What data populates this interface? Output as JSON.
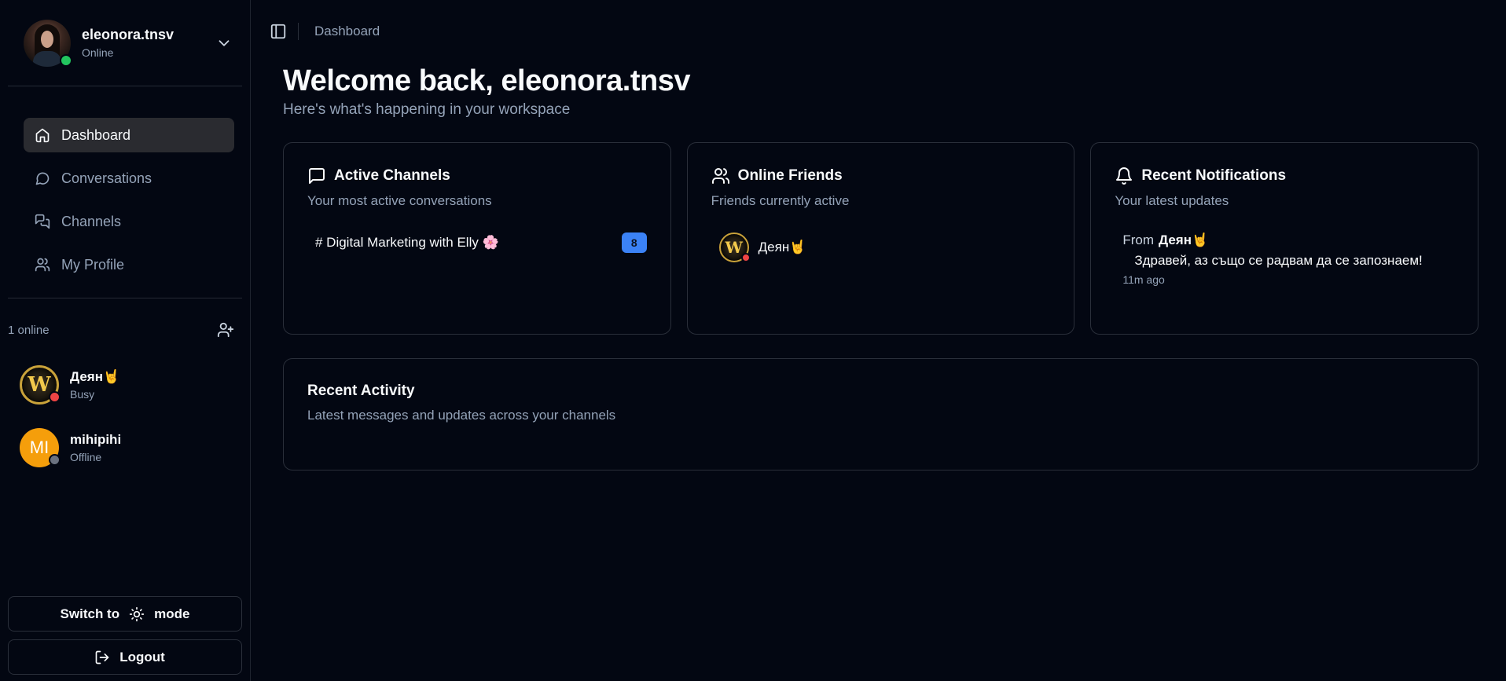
{
  "colors": {
    "background": "#030712",
    "accent": "#3b82f6",
    "online": "#22c55e",
    "busy": "#ef4444",
    "offline": "#6b7280",
    "initials_bg": "#f59e0b"
  },
  "sidebar": {
    "user": {
      "name": "eleonora.tnsv",
      "status": "Online"
    },
    "nav": [
      {
        "label": "Dashboard",
        "icon": "home-icon",
        "active": true
      },
      {
        "label": "Conversations",
        "icon": "chat-bubble-icon"
      },
      {
        "label": "Channels",
        "icon": "chat-bubbles-icon"
      },
      {
        "label": "My Profile",
        "icon": "users-icon"
      }
    ],
    "online_count": "1 online",
    "friends": [
      {
        "name": "Деян🤘",
        "status": "Busy",
        "status_color": "busy"
      },
      {
        "name": "mihipihi",
        "initials": "MI",
        "status": "Offline",
        "status_color": "offline"
      }
    ],
    "theme_button": {
      "prefix": "Switch to",
      "suffix": "mode"
    },
    "logout_label": "Logout"
  },
  "topbar": {
    "breadcrumb": "Dashboard"
  },
  "main": {
    "welcome": "Welcome back, eleonora.tnsv",
    "subtitle": "Here's what's happening in your workspace",
    "cards": {
      "channels": {
        "title": "Active Channels",
        "description": "Your most active conversations",
        "items": [
          {
            "name": "# Digital Marketing with Elly 🌸",
            "count": "8"
          }
        ]
      },
      "friends": {
        "title": "Online Friends",
        "description": "Friends currently active",
        "items": [
          {
            "name": "Деян🤘"
          }
        ]
      },
      "notifications": {
        "title": "Recent Notifications",
        "description": "Your latest updates",
        "items": [
          {
            "from_label": "From",
            "from": "Деян🤘",
            "message": "Здравей, аз също се радвам да се запознаем!",
            "time": "11m ago"
          }
        ]
      }
    },
    "activity": {
      "title": "Recent Activity",
      "description": "Latest messages and updates across your channels"
    }
  }
}
